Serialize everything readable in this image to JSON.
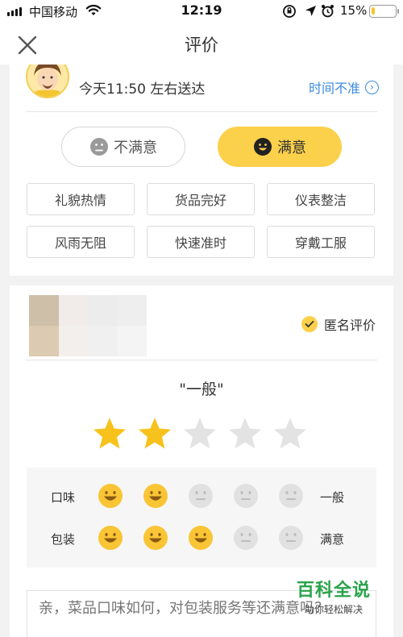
{
  "status_bar": {
    "carrier": "中国移动",
    "time": "12:19",
    "battery_percent_text": "15%",
    "battery_level": 0.15
  },
  "nav": {
    "title": "评价"
  },
  "rider": {
    "eta": "今天11:50 左右送达",
    "time_inaccurate_label": "时间不准",
    "dissatisfied_label": "不满意",
    "satisfied_label": "满意",
    "selected": "satisfied",
    "tags": [
      "礼貌热情",
      "货品完好",
      "仪表整洁",
      "风雨无阻",
      "快速准时",
      "穿戴工服"
    ]
  },
  "food": {
    "anonymous_label": "匿名评价",
    "anonymous_checked": true,
    "rating_text": "\"一般\"",
    "stars_filled": 2,
    "stars_total": 5,
    "sub_ratings": [
      {
        "label": "口味",
        "level": 2,
        "result": "一般"
      },
      {
        "label": "包装",
        "level": 3,
        "result": "满意"
      }
    ],
    "comment_placeholder": "亲，菜品口味如何，对包装服务等还满意吗？"
  },
  "watermark": {
    "title": "百科全说",
    "subtitle": "助你轻松解决"
  },
  "colors": {
    "accent_yellow": "#fbd14b",
    "star_filled": "#f7c21c",
    "star_empty": "#e3e3e3",
    "link_blue": "#3b8be0",
    "watermark_green": "#2aa34a"
  },
  "icons": [
    "signal-icon",
    "wifi-icon",
    "rotation-lock-icon",
    "location-icon",
    "alarm-icon",
    "battery-icon",
    "close-icon",
    "rider-avatar",
    "info-circle-icon",
    "sad-face-icon",
    "smile-face-icon",
    "check-icon",
    "star-icon",
    "emoji-face-icon"
  ]
}
